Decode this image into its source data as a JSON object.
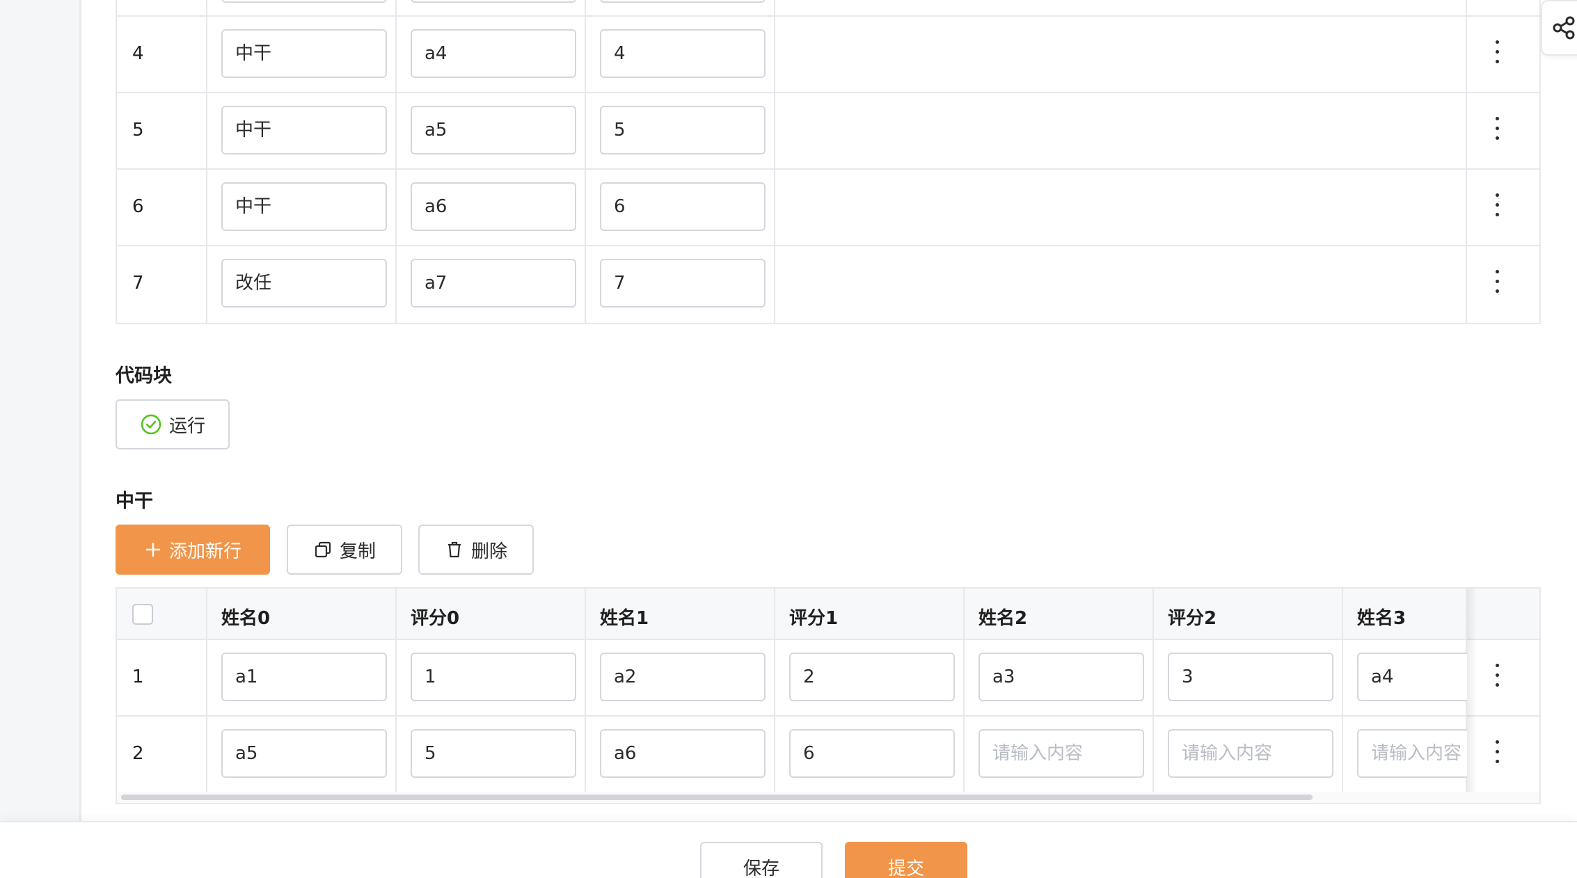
{
  "upper_table": {
    "rows": [
      {
        "index": "4",
        "col1": "中干",
        "col2": "a4",
        "col3": "4"
      },
      {
        "index": "5",
        "col1": "中干",
        "col2": "a5",
        "col3": "5"
      },
      {
        "index": "6",
        "col1": "中干",
        "col2": "a6",
        "col3": "6"
      },
      {
        "index": "7",
        "col1": "改任",
        "col2": "a7",
        "col3": "7"
      }
    ]
  },
  "code_block": {
    "title": "代码块",
    "run_label": "运行"
  },
  "zhonggan": {
    "title": "中干",
    "add_row_label": "添加新行",
    "copy_label": "复制",
    "delete_label": "删除",
    "headers": [
      "姓名0",
      "评分0",
      "姓名1",
      "评分1",
      "姓名2",
      "评分2",
      "姓名3"
    ],
    "placeholder": "请输入内容",
    "rows": [
      {
        "index": "1",
        "values": [
          "a1",
          "1",
          "a2",
          "2",
          "a3",
          "3",
          "a4"
        ]
      },
      {
        "index": "2",
        "values": [
          "a5",
          "5",
          "a6",
          "6",
          "",
          "",
          ""
        ]
      }
    ]
  },
  "footer": {
    "save_label": "保存",
    "submit_label": "提交"
  },
  "colors": {
    "primary": "#f0954a",
    "run_icon": "#52c41a"
  },
  "icons": {
    "share": "share-icon",
    "run": "check-circle-icon",
    "add": "plus-icon",
    "copy": "copy-icon",
    "delete": "trash-icon",
    "more": "more-vertical-icon"
  }
}
